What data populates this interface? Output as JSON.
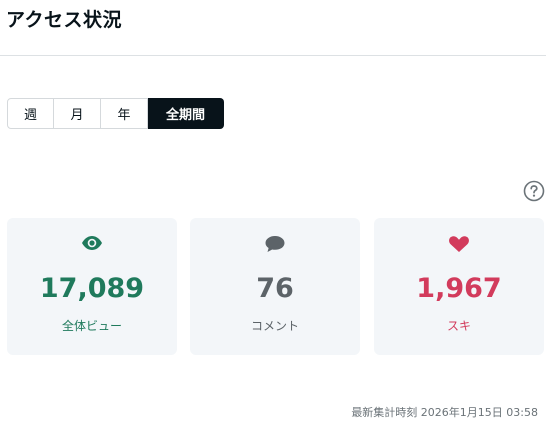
{
  "header": {
    "title": "アクセス状況"
  },
  "period_tabs": [
    {
      "label": "週",
      "active": false
    },
    {
      "label": "月",
      "active": false
    },
    {
      "label": "年",
      "active": false
    },
    {
      "label": "全期間",
      "active": true
    }
  ],
  "help": {
    "icon": "help-circle-icon"
  },
  "stats": {
    "views": {
      "icon": "eye-icon",
      "value": "17,089",
      "label": "全体ビュー",
      "color": "#1f7a5c"
    },
    "comments": {
      "icon": "speech-bubble-icon",
      "value": "76",
      "label": "コメント",
      "color": "#5c6368"
    },
    "likes": {
      "icon": "heart-icon",
      "value": "1,967",
      "label": "スキ",
      "color": "#d23b5c"
    }
  },
  "footer": {
    "updated_text": "最新集計時刻 2026年1月15日 03:58"
  }
}
